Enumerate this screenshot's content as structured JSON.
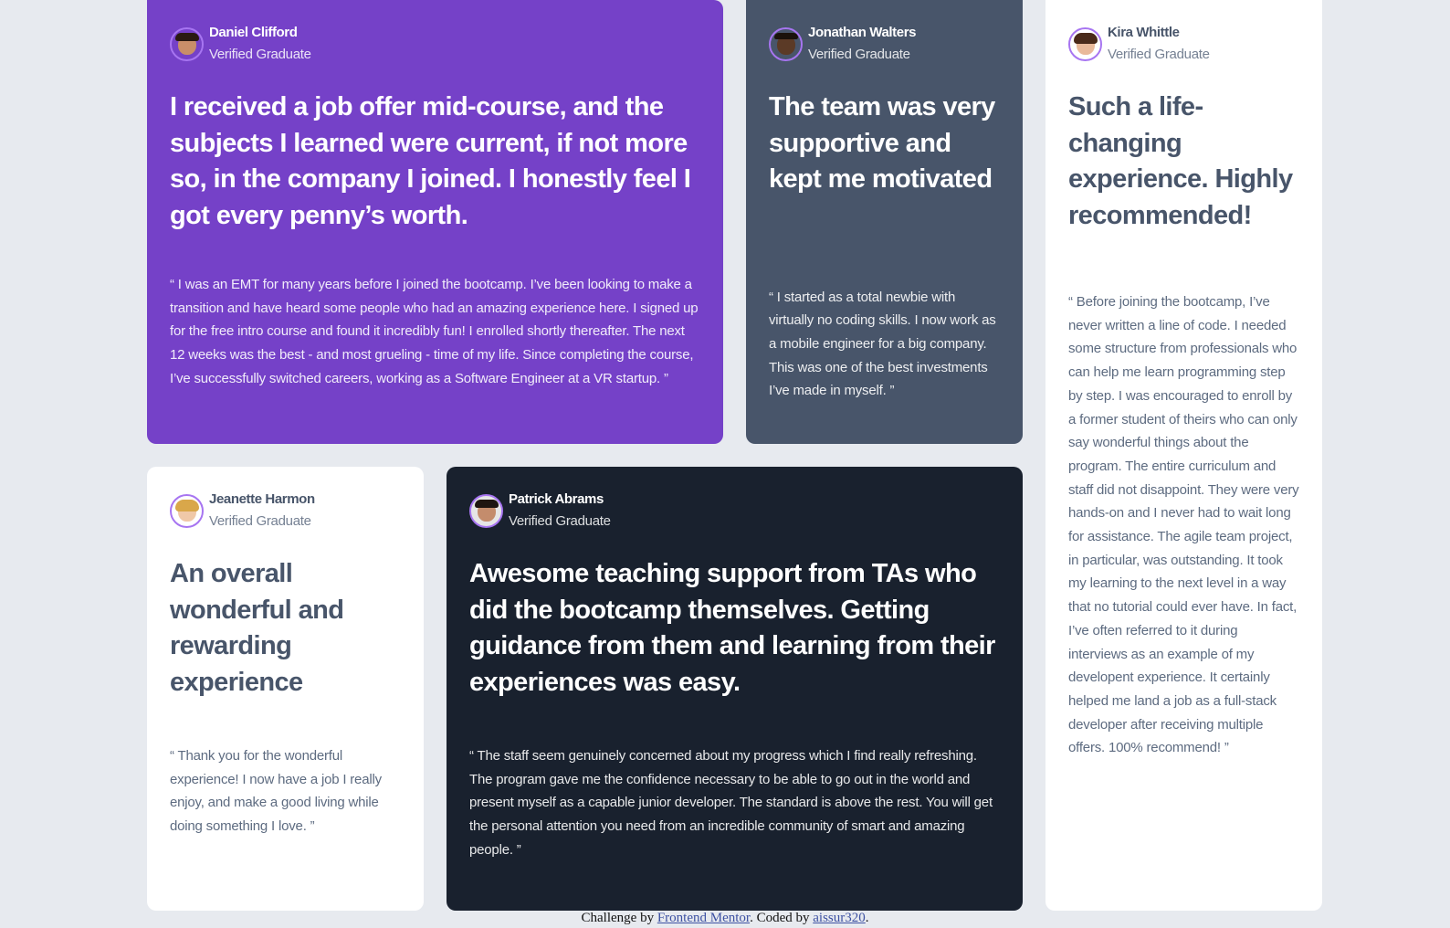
{
  "testimonials": [
    {
      "name": "Daniel Clifford",
      "role": "Verified Graduate",
      "headline": "I received a job offer mid-course, and the subjects I learned were current, if not more so, in the company I joined. I honestly feel I got every penny’s worth.",
      "quote": "“ I was an EMT for many years before I joined the bootcamp. I’ve been looking to make a transition and have heard some people who had an amazing experience here. I signed up for the free intro course and found it incredibly fun! I enrolled shortly thereafter. The next 12 weeks was the best - and most grueling - time of my life. Since completing the course, I’ve successfully switched careers, working as a Software Engineer at a VR startup. ”"
    },
    {
      "name": "Jonathan Walters",
      "role": "Verified Graduate",
      "headline": "The team was very supportive and kept me motivated",
      "quote": "“ I started as a total newbie with virtually no coding skills. I now work as a mobile engineer for a big company. This was one of the best investments I’ve made in myself. ”"
    },
    {
      "name": "Kira Whittle",
      "role": "Verified Graduate",
      "headline": "Such a life-changing experience. Highly recommended!",
      "quote": "“ Before joining the bootcamp, I’ve never written a line of code. I needed some structure from professionals who can help me learn programming step by step. I was encouraged to enroll by a former student of theirs who can only say wonderful things about the program. The entire curriculum and staff did not disappoint. They were very hands-on and I never had to wait long for assistance. The agile team project, in particular, was outstanding. It took my learning to the next level in a way that no tutorial could ever have. In fact, I’ve often referred to it during interviews as an example of my developent experience. It certainly helped me land a job as a full-stack developer after receiving multiple offers. 100% recommend! ”"
    },
    {
      "name": "Jeanette Harmon",
      "role": "Verified Graduate",
      "headline": "An overall wonderful and rewarding experience",
      "quote": "“ Thank you for the wonderful experience! I now have a job I really enjoy, and make a good living while doing something I love. ”"
    },
    {
      "name": "Patrick Abrams",
      "role": "Verified Graduate",
      "headline": "Awesome teaching support from TAs who did the bootcamp themselves. Getting guidance from them and learning from their experiences was easy.",
      "quote": "“ The staff seem genuinely concerned about my progress which I find really refreshing. The program gave me the confidence necessary to be able to go out in the world and present myself as a capable junior developer. The standard is above the rest. You will get the personal attention you need from an incredible community of smart and amazing people. ”"
    }
  ],
  "footer": {
    "prefix": "Challenge by ",
    "link1": "Frontend Mentor",
    "middle": ". Coded by ",
    "link2": "aissur320",
    "suffix": "."
  },
  "colors": {
    "purple": "#7541c8",
    "slate": "#48556a",
    "dark": "#19212e",
    "white": "#ffffff",
    "background": "#e7eaef",
    "avatar_border": "#a775f1"
  },
  "icons": [
    "avatar-daniel",
    "avatar-jonathan",
    "avatar-kira",
    "avatar-jeanette",
    "avatar-patrick"
  ]
}
